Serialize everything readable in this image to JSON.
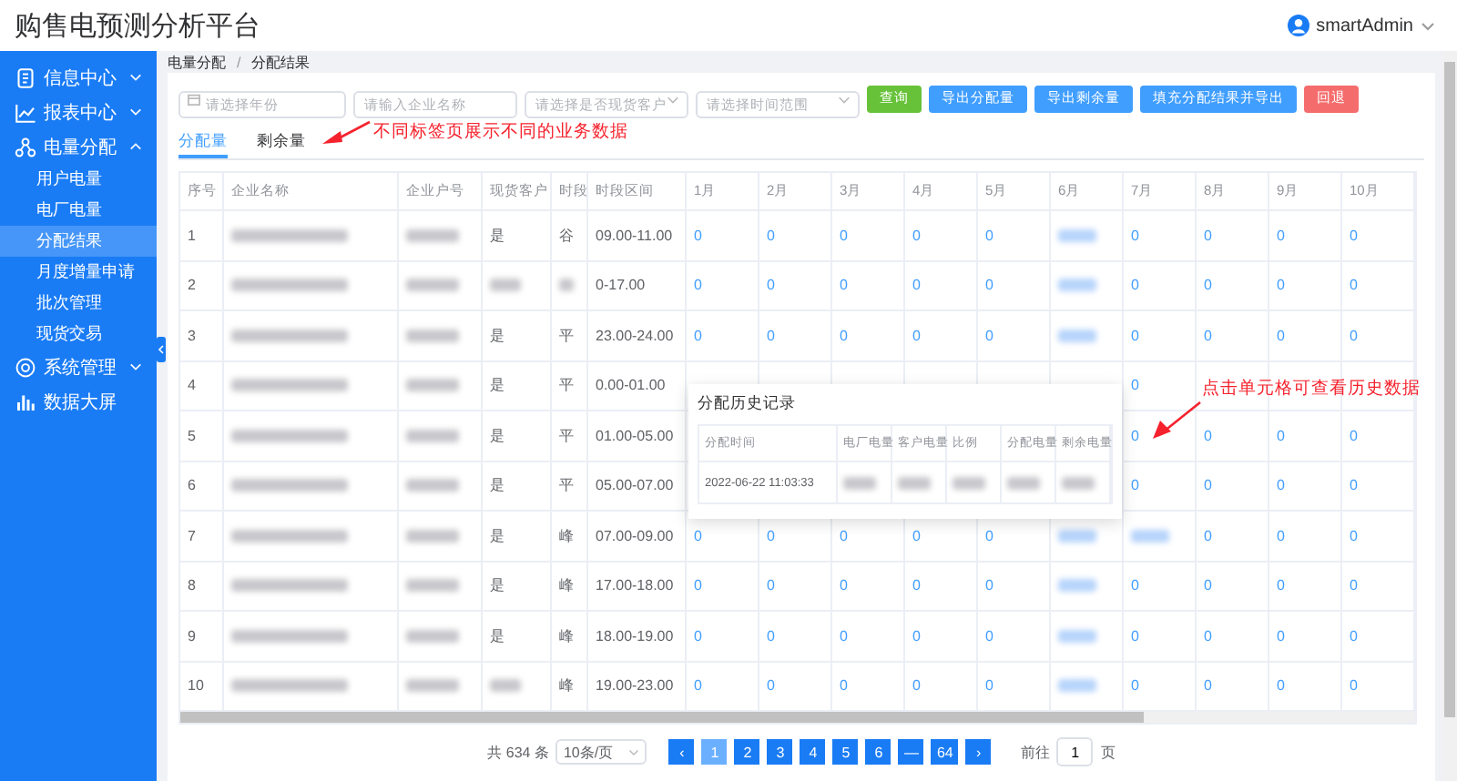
{
  "app_title": "购售电预测分析平台",
  "user": {
    "name": "smartAdmin"
  },
  "sidebar": {
    "items": [
      {
        "label": "信息中心",
        "expanded": false
      },
      {
        "label": "报表中心",
        "expanded": false
      },
      {
        "label": "电量分配",
        "expanded": true,
        "children": [
          {
            "label": "用户电量",
            "selected": false
          },
          {
            "label": "电厂电量",
            "selected": false
          },
          {
            "label": "分配结果",
            "selected": true
          },
          {
            "label": "月度增量申请",
            "selected": false
          },
          {
            "label": "批次管理",
            "selected": false
          },
          {
            "label": "现货交易",
            "selected": false
          }
        ]
      },
      {
        "label": "系统管理",
        "expanded": false
      },
      {
        "label": "数据大屏"
      }
    ]
  },
  "breadcrumb": [
    "电量分配",
    "分配结果"
  ],
  "breadcrumb_separator": "/",
  "filters": [
    {
      "kind": "date",
      "placeholder": "请选择年份"
    },
    {
      "kind": "text",
      "placeholder": "请输入企业名称"
    },
    {
      "kind": "select",
      "placeholder": "请选择是否现货客户"
    },
    {
      "kind": "select",
      "placeholder": "请选择时间范围"
    }
  ],
  "buttons": [
    {
      "label": "查询",
      "kind": "success"
    },
    {
      "label": "导出分配量",
      "kind": "primary"
    },
    {
      "label": "导出剩余量",
      "kind": "primary"
    },
    {
      "label": "填充分配结果并导出",
      "kind": "primary"
    },
    {
      "label": "回退",
      "kind": "danger"
    }
  ],
  "tabs": [
    {
      "label": "分配量",
      "selected": true
    },
    {
      "label": "剩余量",
      "selected": false
    }
  ],
  "annotations": [
    "不同标签页展示不同的业务数据",
    "点击单元格可查看历史数据"
  ],
  "table": {
    "columns": [
      "序号",
      "企业名称",
      "企业户号",
      "现货客户",
      "时段",
      "时段区间",
      "1月",
      "2月",
      "3月",
      "4月",
      "5月",
      "6月",
      "7月",
      "8月",
      "9月",
      "10月"
    ],
    "rows": [
      [
        "1",
        {
          "kind": "redacted"
        },
        {
          "kind": "redacted"
        },
        "是",
        "谷",
        "09.00-11.00",
        "0",
        "0",
        "0",
        "0",
        "0",
        {
          "kind": "redacted"
        },
        "0",
        "0",
        "0",
        "0"
      ],
      [
        "2",
        {
          "kind": "redacted"
        },
        {
          "kind": "redacted"
        },
        {
          "kind": "redacted"
        },
        {
          "kind": "redacted"
        },
        "0-17.00",
        "0",
        "0",
        "0",
        "0",
        "0",
        {
          "kind": "redacted"
        },
        "0",
        "0",
        "0",
        "0"
      ],
      [
        "3",
        {
          "kind": "redacted"
        },
        {
          "kind": "redacted"
        },
        "是",
        "平",
        "23.00-24.00",
        "0",
        "0",
        "0",
        "0",
        "0",
        {
          "kind": "redacted"
        },
        "0",
        "0",
        "0",
        "0"
      ],
      [
        "4",
        {
          "kind": "redacted"
        },
        {
          "kind": "redacted"
        },
        "是",
        "平",
        "0.00-01.00",
        null,
        null,
        null,
        null,
        null,
        null,
        "0",
        null,
        null,
        null
      ],
      [
        "5",
        {
          "kind": "redacted"
        },
        {
          "kind": "redacted"
        },
        "是",
        "平",
        "01.00-05.00",
        null,
        null,
        null,
        null,
        null,
        null,
        "0",
        "0",
        "0",
        "0"
      ],
      [
        "6",
        {
          "kind": "redacted"
        },
        {
          "kind": "redacted"
        },
        "是",
        "平",
        "05.00-07.00",
        null,
        null,
        null,
        null,
        null,
        null,
        "0",
        "0",
        "0",
        "0"
      ],
      [
        "7",
        {
          "kind": "redacted"
        },
        {
          "kind": "redacted"
        },
        "是",
        "峰",
        "07.00-09.00",
        "0",
        "0",
        "0",
        "0",
        "0",
        {
          "kind": "redacted"
        },
        {
          "kind": "redacted"
        },
        "0",
        "0",
        "0"
      ],
      [
        "8",
        {
          "kind": "redacted"
        },
        {
          "kind": "redacted"
        },
        "是",
        "峰",
        "17.00-18.00",
        "0",
        "0",
        "0",
        "0",
        "0",
        {
          "kind": "redacted"
        },
        "0",
        "0",
        "0",
        "0"
      ],
      [
        "9",
        {
          "kind": "redacted"
        },
        {
          "kind": "redacted"
        },
        "是",
        "峰",
        "18.00-19.00",
        "0",
        "0",
        "0",
        "0",
        "0",
        {
          "kind": "redacted"
        },
        "0",
        "0",
        "0",
        "0"
      ],
      [
        "10",
        {
          "kind": "redacted"
        },
        {
          "kind": "redacted"
        },
        {
          "kind": "redacted"
        },
        "峰",
        "19.00-23.00",
        "0",
        "0",
        "0",
        "0",
        "0",
        {
          "kind": "redacted"
        },
        "0",
        "0",
        "0",
        "0"
      ]
    ]
  },
  "popup": {
    "title": "分配历史记录",
    "columns": [
      "分配时间",
      "电厂电量",
      "客户电量",
      "比例",
      "分配电量",
      "剩余电量"
    ],
    "rows": [
      [
        "2022-06-22 11:03:33",
        {
          "kind": "redacted"
        },
        {
          "kind": "redacted"
        },
        {
          "kind": "redacted"
        },
        {
          "kind": "redacted"
        },
        {
          "kind": "redacted"
        }
      ]
    ]
  },
  "pagination": {
    "total": "共 634 条",
    "page_size": "10条/页",
    "prev": "‹",
    "pages": [
      {
        "label": "1",
        "selected": true
      },
      {
        "label": "2",
        "selected": false
      },
      {
        "label": "3",
        "selected": false
      },
      {
        "label": "4",
        "selected": false
      },
      {
        "label": "5",
        "selected": false
      },
      {
        "label": "6",
        "selected": false
      },
      {
        "label": "—",
        "selected": false
      },
      {
        "label": "64",
        "selected": false
      }
    ],
    "next": "›",
    "goto_label": "前往",
    "goto_value": "1",
    "goto_suffix": "页"
  }
}
